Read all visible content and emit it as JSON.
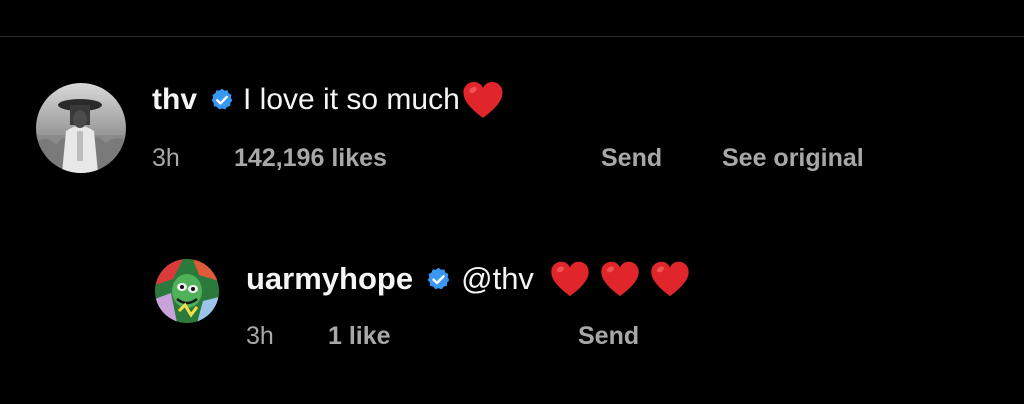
{
  "comments": [
    {
      "username": "thv",
      "verified": true,
      "text": "I love it so much",
      "emoji": [
        "red-heart"
      ],
      "time": "3h",
      "likes": "142,196 likes",
      "send": "Send",
      "see_original": "See original"
    },
    {
      "username": "uarmyhope",
      "verified": true,
      "text": "@thv",
      "emoji": [
        "red-heart",
        "red-heart",
        "red-heart"
      ],
      "time": "3h",
      "likes": "1 like",
      "send": "Send"
    }
  ],
  "colors": {
    "background": "#000000",
    "primary_text": "#f5f5f5",
    "secondary_text": "#a8a8a8",
    "verified_badge": "#3897f0",
    "heart": "#e0262a",
    "divider": "#2a2a2a"
  }
}
